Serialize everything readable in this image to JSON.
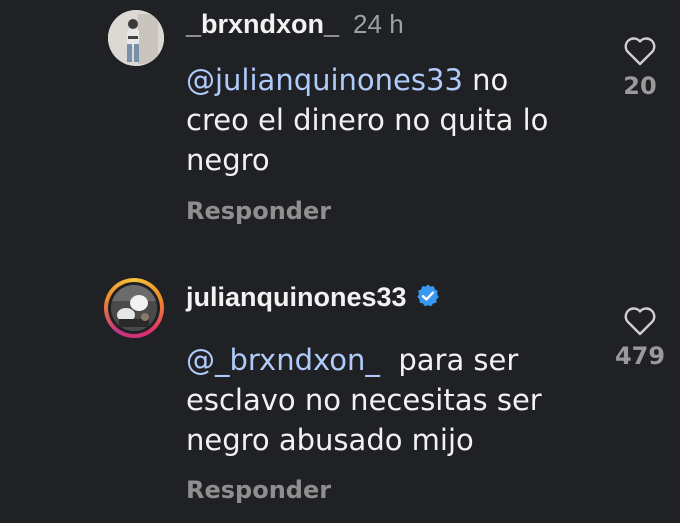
{
  "comments": [
    {
      "username": "_brxndxon_",
      "time": "24 h",
      "mention": "@julianquinones33",
      "text": " no creo el dinero no quita lo negro",
      "reply_label": "Responder",
      "likes": "20",
      "icon": "heart-outline-icon"
    },
    {
      "username": "julianquinones33",
      "verified": true,
      "mention": "@_brxndxon_",
      "text": "  para ser esclavo no necesitas ser negro abusado mijo",
      "reply_label": "Responder",
      "likes": "479",
      "icon": "heart-outline-icon"
    }
  ],
  "colors": {
    "background": "#202124",
    "mention": "#aecbfa",
    "verified_badge": "#3897f0",
    "muted": "#8f8f8f"
  }
}
